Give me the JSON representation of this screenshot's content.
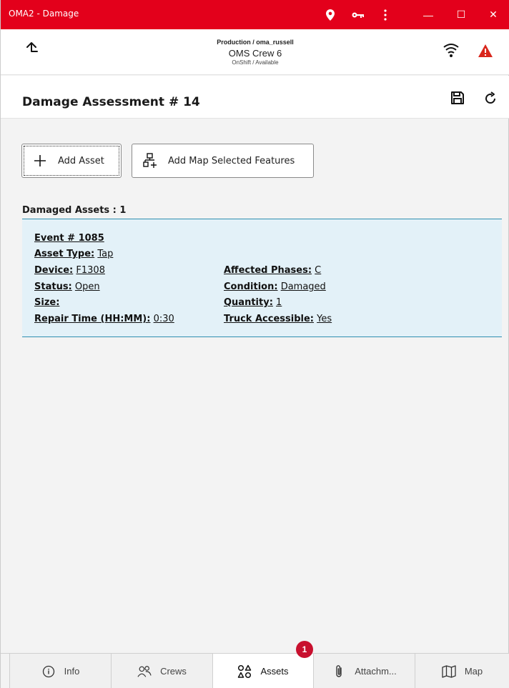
{
  "window": {
    "title": "OMA2 - Damage",
    "controls": {
      "minimize": "—",
      "maximize": "☐",
      "close": "✕"
    },
    "accent": "#e3001b"
  },
  "header": {
    "environment": "Production / oma_russell",
    "crew_name": "OMS Crew 6",
    "crew_status": "OnShift / Available",
    "icons": [
      "up-arrow-icon",
      "wifi-icon",
      "warning-icon"
    ]
  },
  "page": {
    "title": "Damage Assessment # 14",
    "icons": [
      "save-icon",
      "refresh-icon"
    ]
  },
  "actions": {
    "add_asset": "Add Asset",
    "add_map_features": "Add Map Selected Features"
  },
  "assets": {
    "section_title": "Damaged Assets : 1",
    "items": [
      {
        "event": "Event # 1085",
        "asset_type_label": "Asset Type:",
        "asset_type": "Tap",
        "device_label": "Device:",
        "device": "F1308",
        "affected_phases_label": "Affected Phases:",
        "affected_phases": "C",
        "status_label": "Status:",
        "status": "Open",
        "condition_label": "Condition:",
        "condition": "Damaged",
        "size_label": "Size:",
        "size": "",
        "quantity_label": "Quantity:",
        "quantity": "1",
        "repair_time_label": "Repair Time (HH:MM):",
        "repair_time": "0:30",
        "truck_accessible_label": "Truck Accessible:",
        "truck_accessible": "Yes"
      }
    ]
  },
  "tabs": [
    {
      "label": "Info",
      "icon": "info-icon"
    },
    {
      "label": "Crews",
      "icon": "people-icon"
    },
    {
      "label": "Assets",
      "icon": "shapes-icon",
      "badge": "1"
    },
    {
      "label": "Attachm...",
      "icon": "paperclip-icon"
    },
    {
      "label": "Map",
      "icon": "map-icon"
    }
  ]
}
